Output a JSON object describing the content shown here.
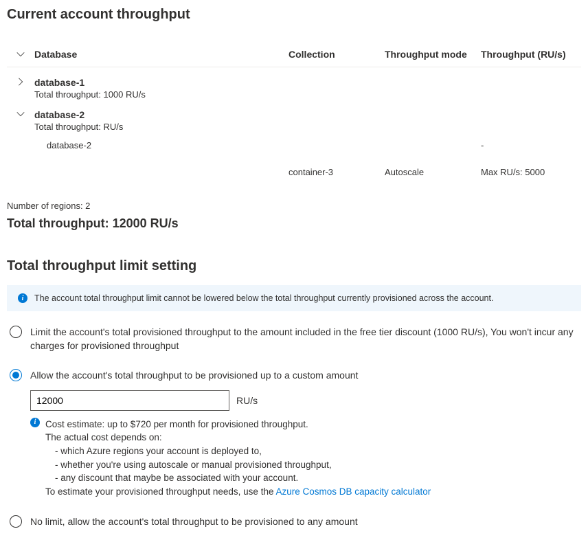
{
  "page_title": "Current account throughput",
  "table": {
    "headers": {
      "database": "Database",
      "collection": "Collection",
      "mode": "Throughput mode",
      "throughput": "Throughput (RU/s)"
    },
    "db1": {
      "name": "database-1",
      "sub": "Total throughput: 1000 RU/s"
    },
    "db2": {
      "name": "database-2",
      "sub": "Total throughput: RU/s",
      "row1": {
        "name": "database-2",
        "throughput": "-"
      },
      "row2": {
        "collection": "container-3",
        "mode": "Autoscale",
        "throughput": "Max RU/s: 5000"
      }
    }
  },
  "regions_label": "Number of regions: 2",
  "total_throughput": "Total throughput: 12000 RU/s",
  "section_title": "Total throughput limit setting",
  "banner_text": "The account total throughput limit cannot be lowered below the total throughput currently provisioned across the account.",
  "options": {
    "free_tier": "Limit the account's total provisioned throughput to the amount included in the free tier discount (1000 RU/s), You won't incur any charges for provisioned throughput",
    "custom": "Allow the account's total throughput to be provisioned up to a custom amount",
    "custom_value": "12000",
    "custom_unit": "RU/s",
    "no_limit": "No limit, allow the account's total throughput to be provisioned to any amount"
  },
  "cost": {
    "line1": "Cost estimate: up to $720 per month for provisioned throughput.",
    "line2": "The actual cost depends on:",
    "line3": "- which Azure regions your account is deployed to,",
    "line4": "- whether you're using autoscale or manual provisioned throughput,",
    "line5": "- any discount that maybe be associated with your account.",
    "line6_prefix": "To estimate your provisioned throughput needs, use the ",
    "link_text": "Azure Cosmos DB capacity calculator"
  }
}
